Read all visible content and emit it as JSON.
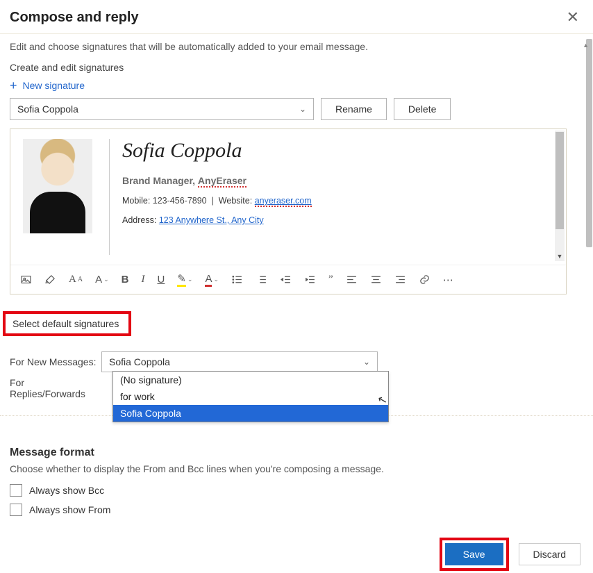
{
  "header": {
    "title": "Compose and reply"
  },
  "intro": {
    "description": "Edit and choose signatures that will be automatically added to your email message.",
    "create_label": "Create and edit signatures",
    "new_signature": "New signature"
  },
  "signature_picker": {
    "selected": "Sofia Coppola",
    "rename": "Rename",
    "delete": "Delete"
  },
  "signature_body": {
    "name": "Sofia Coppola",
    "title_text": "Brand Manager, ",
    "company_red": "AnyEraser",
    "mobile_label": "Mobile:",
    "mobile": "123-456-7890",
    "sep": "|",
    "website_label": "Website:",
    "website": "anyeraser.com",
    "address_label": "Address:",
    "address": "123 Anywhere St., Any City"
  },
  "defaults": {
    "section_title": "Select default signatures",
    "new_messages_label": "For New Messages:",
    "new_messages_value": "Sofia Coppola",
    "replies_label": "For Replies/Forwards",
    "dropdown_options": [
      {
        "label": "(No signature)",
        "selected": false
      },
      {
        "label": "for work",
        "selected": false
      },
      {
        "label": "Sofia Coppola",
        "selected": true
      }
    ]
  },
  "message_format": {
    "title": "Message format",
    "description": "Choose whether to display the From and Bcc lines when you're composing a message.",
    "always_bcc": "Always show Bcc",
    "always_from": "Always show From"
  },
  "footer": {
    "save": "Save",
    "discard": "Discard"
  }
}
